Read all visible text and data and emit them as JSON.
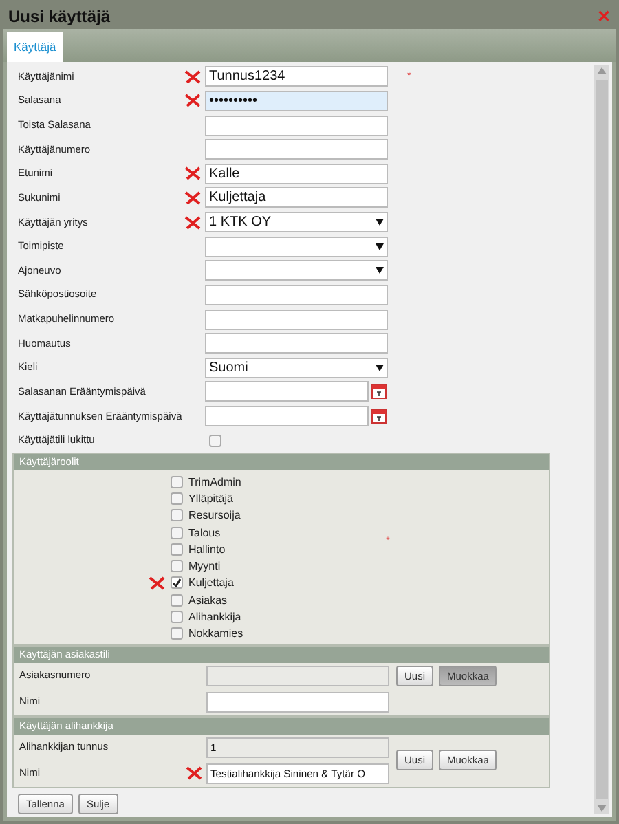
{
  "window": {
    "title": "Uusi käyttäjä",
    "close": "✕"
  },
  "tabs": [
    {
      "label": "Käyttäjä",
      "selected": true
    }
  ],
  "fields": [
    {
      "label": "Käyttäjänimi",
      "kind": "text",
      "value": "Tunnus1234",
      "marked": true,
      "required_mark": "*",
      "focused": false
    },
    {
      "label": "Salasana",
      "kind": "text",
      "value": "••••••••••",
      "marked": true,
      "focused": true
    },
    {
      "label": "Toista Salasana",
      "kind": "text",
      "marked": false,
      "focused": false
    },
    {
      "label": "Käyttäjänumero",
      "kind": "text",
      "marked": false,
      "focused": false
    },
    {
      "label": "Etunimi",
      "kind": "text",
      "value": "Kalle",
      "marked": true,
      "focused": false
    },
    {
      "label": "Sukunimi",
      "kind": "text",
      "value": "Kuljettaja",
      "marked": true,
      "focused": false
    },
    {
      "label": "Käyttäjän yritys",
      "kind": "select",
      "value": "1 KTK OY",
      "marked": true,
      "focused": false
    },
    {
      "label": "Toimipiste",
      "kind": "select",
      "marked": false,
      "focused": false
    },
    {
      "label": "Ajoneuvo",
      "kind": "select",
      "marked": false,
      "focused": false
    },
    {
      "label": "Sähköpostiosoite",
      "kind": "text",
      "marked": false,
      "focused": false
    },
    {
      "label": "Matkapuhelinnumero",
      "kind": "text",
      "marked": false,
      "focused": false
    },
    {
      "label": "Huomautus",
      "kind": "text",
      "marked": false,
      "focused": false
    },
    {
      "label": "Kieli",
      "kind": "select",
      "value": "Suomi",
      "marked": false,
      "focused": false
    },
    {
      "label": "Salasanan Erääntymispäivä",
      "kind": "date",
      "marked": false,
      "focused": false
    },
    {
      "label": "Käyttäjätunnuksen Erääntymispäivä",
      "kind": "date",
      "marked": false,
      "focused": false
    },
    {
      "label": "Käyttäjätili lukittu",
      "kind": "checkbox",
      "checked": false,
      "marked": false
    }
  ],
  "roles": {
    "title": "Käyttäjäroolit",
    "required_mark": "*",
    "items": [
      {
        "label": "TrimAdmin",
        "checked": false,
        "marked": false
      },
      {
        "label": "Ylläpitäjä",
        "checked": false,
        "marked": false
      },
      {
        "label": "Resursoija",
        "checked": false,
        "marked": false
      },
      {
        "label": "Talous",
        "checked": false,
        "marked": false
      },
      {
        "label": "Hallinto",
        "checked": false,
        "marked": false
      },
      {
        "label": "Myynti",
        "checked": false,
        "marked": false
      },
      {
        "label": "Kuljettaja",
        "checked": true,
        "marked": true
      },
      {
        "label": "Asiakas",
        "checked": false,
        "marked": false
      },
      {
        "label": "Alihankkija",
        "checked": false,
        "marked": false
      },
      {
        "label": "Nokkamies",
        "checked": false,
        "marked": false
      }
    ]
  },
  "subsections": [
    {
      "title": "Käyttäjän asiakastili",
      "rows": [
        {
          "label": "Asiakasnumero",
          "disabled": true,
          "marked": false
        },
        {
          "label": "Nimi",
          "disabled": false,
          "marked": false
        }
      ],
      "buttons": [
        {
          "label": "Uusi",
          "pressed": false
        },
        {
          "label": "Muokkaa",
          "pressed": true
        }
      ]
    },
    {
      "title": "Käyttäjän alihankkija",
      "rows": [
        {
          "label": "Alihankkijan tunnus",
          "value": "1",
          "disabled": true,
          "marked": false
        },
        {
          "label": "Nimi",
          "value": "Testialihankkija Sininen & Tytär O",
          "disabled": false,
          "marked": true
        }
      ],
      "buttons": [
        {
          "label": "Uusi",
          "pressed": false
        },
        {
          "label": "Muokkaa",
          "pressed": false
        }
      ]
    }
  ],
  "footer_buttons": [
    "Tallenna",
    "Sulje"
  ]
}
